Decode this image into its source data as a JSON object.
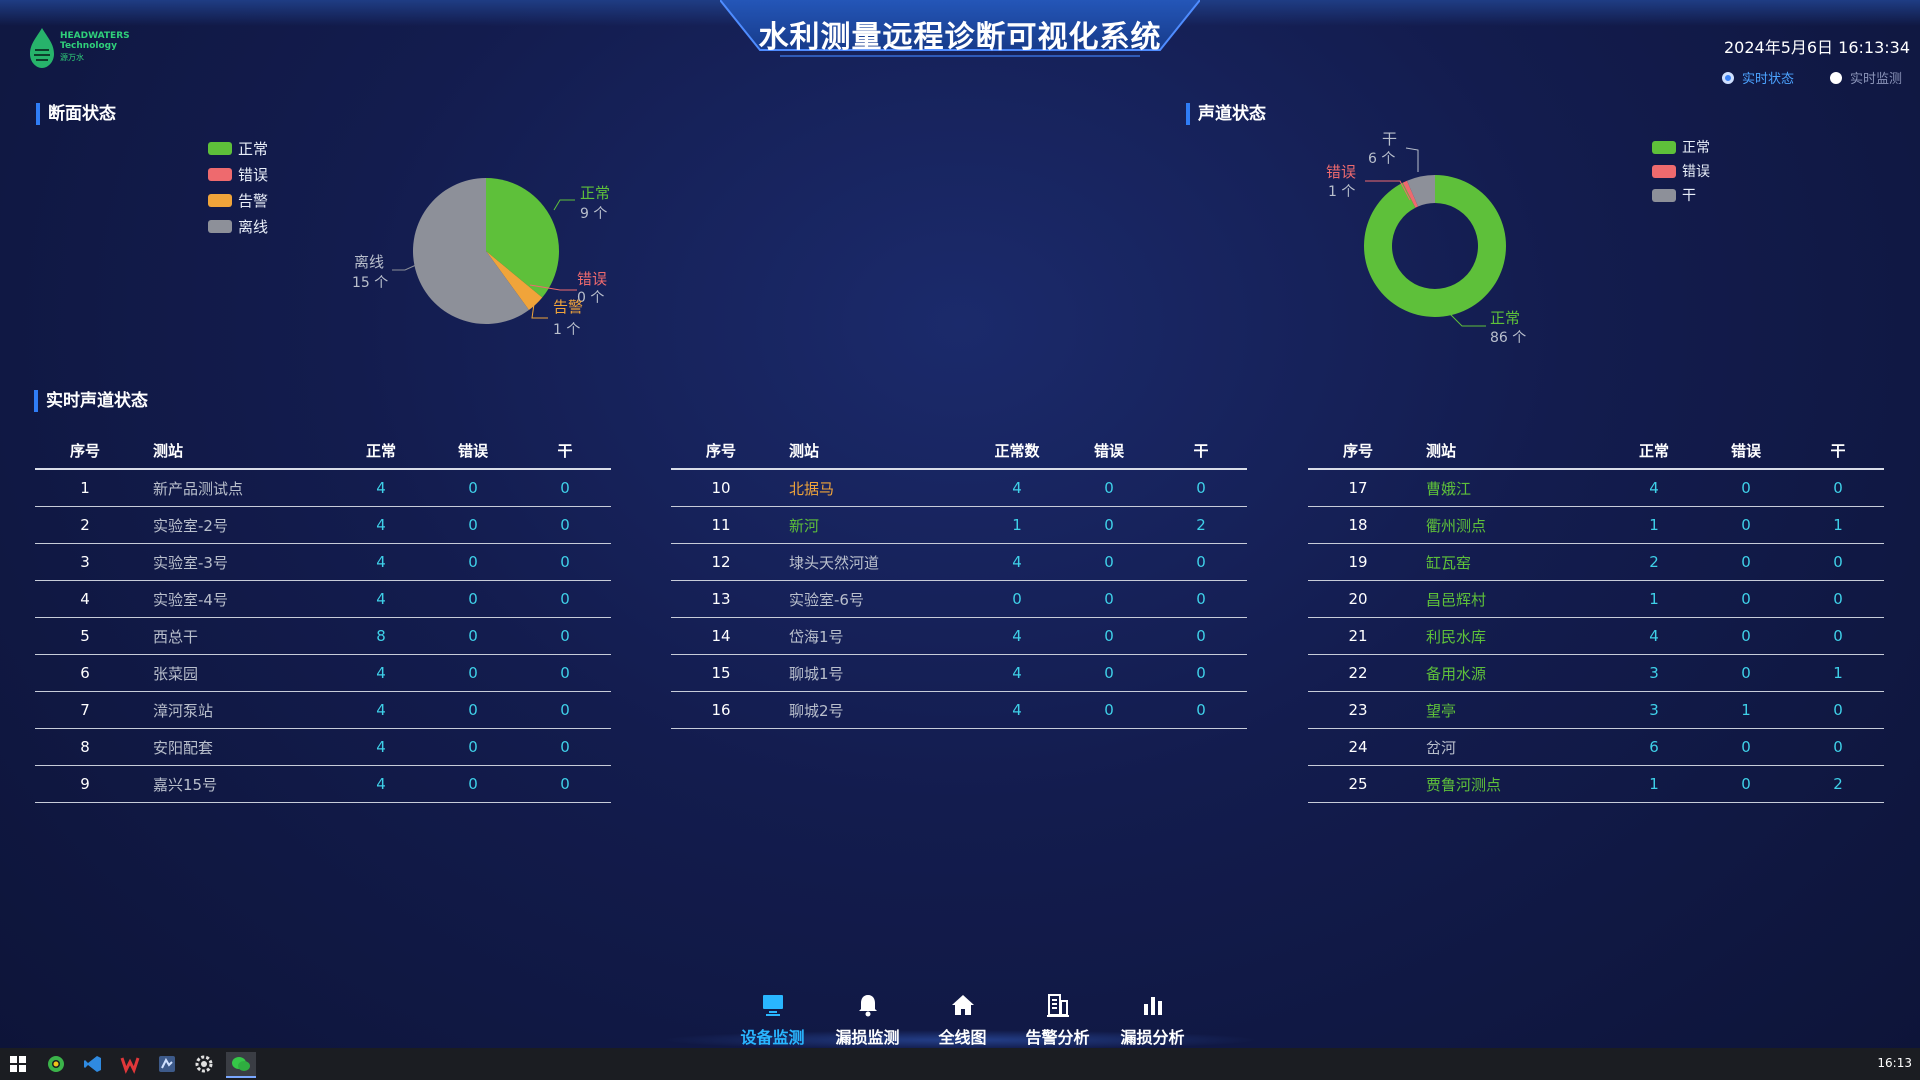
{
  "header": {
    "title": "水利测量远程诊断可视化系统",
    "datetime": "2024年5月6日 16:13:34",
    "logo": {
      "line1": "HEADWATERS",
      "line2": "Technology",
      "line3": "源万水"
    },
    "view_options": [
      {
        "label": "实时状态",
        "selected": true
      },
      {
        "label": "实时监测",
        "selected": false
      }
    ]
  },
  "section_status": {
    "title": "断面状态",
    "legend": [
      {
        "label": "正常",
        "color": "#5ec03a"
      },
      {
        "label": "错误",
        "color": "#ee6a6e"
      },
      {
        "label": "告警",
        "color": "#f0a43a"
      },
      {
        "label": "离线",
        "color": "#8d9099"
      }
    ],
    "pie_labels": {
      "normal": "正常",
      "normal_count": "9 个",
      "error": "错误",
      "error_count": "0 个",
      "warn": "告警",
      "warn_count": "1 个",
      "offline": "离线",
      "offline_count": "15 个"
    }
  },
  "channel_status": {
    "title": "声道状态",
    "legend": [
      {
        "label": "正常",
        "color": "#5ec03a"
      },
      {
        "label": "错误",
        "color": "#ee6a6e"
      },
      {
        "label": "干",
        "color": "#8d9099"
      }
    ],
    "donut_labels": {
      "dry": "干",
      "dry_count": "6 个",
      "error": "错误",
      "error_count": "1 个",
      "normal": "正常",
      "normal_count": "86 个"
    }
  },
  "chart_data": [
    {
      "type": "pie",
      "labels": [
        "正常",
        "错误",
        "告警",
        "离线"
      ],
      "values": [
        9,
        0,
        1,
        15
      ],
      "colors": [
        "#5ec03a",
        "#ee6a6e",
        "#f0a43a",
        "#8d9099"
      ]
    },
    {
      "type": "pie",
      "donut": true,
      "labels": [
        "正常",
        "错误",
        "干"
      ],
      "values": [
        86,
        1,
        6
      ],
      "colors": [
        "#5ec03a",
        "#ee6a6e",
        "#8d9099"
      ]
    }
  ],
  "realtime": {
    "title": "实时声道状态",
    "tables": [
      {
        "headers": [
          "序号",
          "测站",
          "正常",
          "错误",
          "干"
        ],
        "rows": [
          {
            "no": "1",
            "station": "新产品测试点",
            "color": "#b9bfcc",
            "normal": "4",
            "error": "0",
            "dry": "0"
          },
          {
            "no": "2",
            "station": "实验室-2号",
            "color": "#b9bfcc",
            "normal": "4",
            "error": "0",
            "dry": "0"
          },
          {
            "no": "3",
            "station": "实验室-3号",
            "color": "#b9bfcc",
            "normal": "4",
            "error": "0",
            "dry": "0"
          },
          {
            "no": "4",
            "station": "实验室-4号",
            "color": "#b9bfcc",
            "normal": "4",
            "error": "0",
            "dry": "0"
          },
          {
            "no": "5",
            "station": "西总干",
            "color": "#b9bfcc",
            "normal": "8",
            "error": "0",
            "dry": "0"
          },
          {
            "no": "6",
            "station": "张菜园",
            "color": "#b9bfcc",
            "normal": "4",
            "error": "0",
            "dry": "0"
          },
          {
            "no": "7",
            "station": "漳河泵站",
            "color": "#b9bfcc",
            "normal": "4",
            "error": "0",
            "dry": "0"
          },
          {
            "no": "8",
            "station": "安阳配套",
            "color": "#b9bfcc",
            "normal": "4",
            "error": "0",
            "dry": "0"
          },
          {
            "no": "9",
            "station": "嘉兴15号",
            "color": "#b9bfcc",
            "normal": "4",
            "error": "0",
            "dry": "0"
          }
        ]
      },
      {
        "headers": [
          "序号",
          "测站",
          "正常数",
          "错误",
          "干"
        ],
        "rows": [
          {
            "no": "10",
            "station": "北据马",
            "color": "#f0a43a",
            "normal": "4",
            "error": "0",
            "dry": "0"
          },
          {
            "no": "11",
            "station": "新河",
            "color": "#5ec03a",
            "normal": "1",
            "error": "0",
            "dry": "2"
          },
          {
            "no": "12",
            "station": "埭头天然河道",
            "color": "#b9bfcc",
            "normal": "4",
            "error": "0",
            "dry": "0"
          },
          {
            "no": "13",
            "station": "实验室-6号",
            "color": "#b9bfcc",
            "normal": "0",
            "error": "0",
            "dry": "0"
          },
          {
            "no": "14",
            "station": "岱海1号",
            "color": "#b9bfcc",
            "normal": "4",
            "error": "0",
            "dry": "0"
          },
          {
            "no": "15",
            "station": "聊城1号",
            "color": "#b9bfcc",
            "normal": "4",
            "error": "0",
            "dry": "0"
          },
          {
            "no": "16",
            "station": "聊城2号",
            "color": "#b9bfcc",
            "normal": "4",
            "error": "0",
            "dry": "0"
          }
        ]
      },
      {
        "headers": [
          "序号",
          "测站",
          "正常",
          "错误",
          "干"
        ],
        "rows": [
          {
            "no": "17",
            "station": "曹娥江",
            "color": "#5ec03a",
            "normal": "4",
            "error": "0",
            "dry": "0"
          },
          {
            "no": "18",
            "station": "衢州测点",
            "color": "#5ec03a",
            "normal": "1",
            "error": "0",
            "dry": "1"
          },
          {
            "no": "19",
            "station": "缸瓦窑",
            "color": "#5ec03a",
            "normal": "2",
            "error": "0",
            "dry": "0"
          },
          {
            "no": "20",
            "station": "昌邑辉村",
            "color": "#5ec03a",
            "normal": "1",
            "error": "0",
            "dry": "0"
          },
          {
            "no": "21",
            "station": "利民水库",
            "color": "#5ec03a",
            "normal": "4",
            "error": "0",
            "dry": "0"
          },
          {
            "no": "22",
            "station": "备用水源",
            "color": "#5ec03a",
            "normal": "3",
            "error": "0",
            "dry": "1"
          },
          {
            "no": "23",
            "station": "望亭",
            "color": "#5ec03a",
            "normal": "3",
            "error": "1",
            "dry": "0"
          },
          {
            "no": "24",
            "station": "岔河",
            "color": "#b9bfcc",
            "normal": "6",
            "error": "0",
            "dry": "0"
          },
          {
            "no": "25",
            "station": "贾鲁河测点",
            "color": "#5ec03a",
            "normal": "1",
            "error": "0",
            "dry": "2"
          }
        ]
      }
    ]
  },
  "bottom_nav": [
    {
      "label": "设备监测",
      "icon": "monitor-icon",
      "active": true
    },
    {
      "label": "漏损监测",
      "icon": "bell-icon",
      "active": false
    },
    {
      "label": "全线图",
      "icon": "home-icon",
      "active": false
    },
    {
      "label": "告警分析",
      "icon": "report-icon",
      "active": false
    },
    {
      "label": "漏损分析",
      "icon": "bar-chart-icon",
      "active": false
    }
  ],
  "taskbar": {
    "clock": "16:13",
    "icons": [
      "windows-start-icon",
      "browser-icon",
      "vscode-icon",
      "wps-icon",
      "app-icon",
      "settings-icon",
      "wechat-icon"
    ]
  }
}
